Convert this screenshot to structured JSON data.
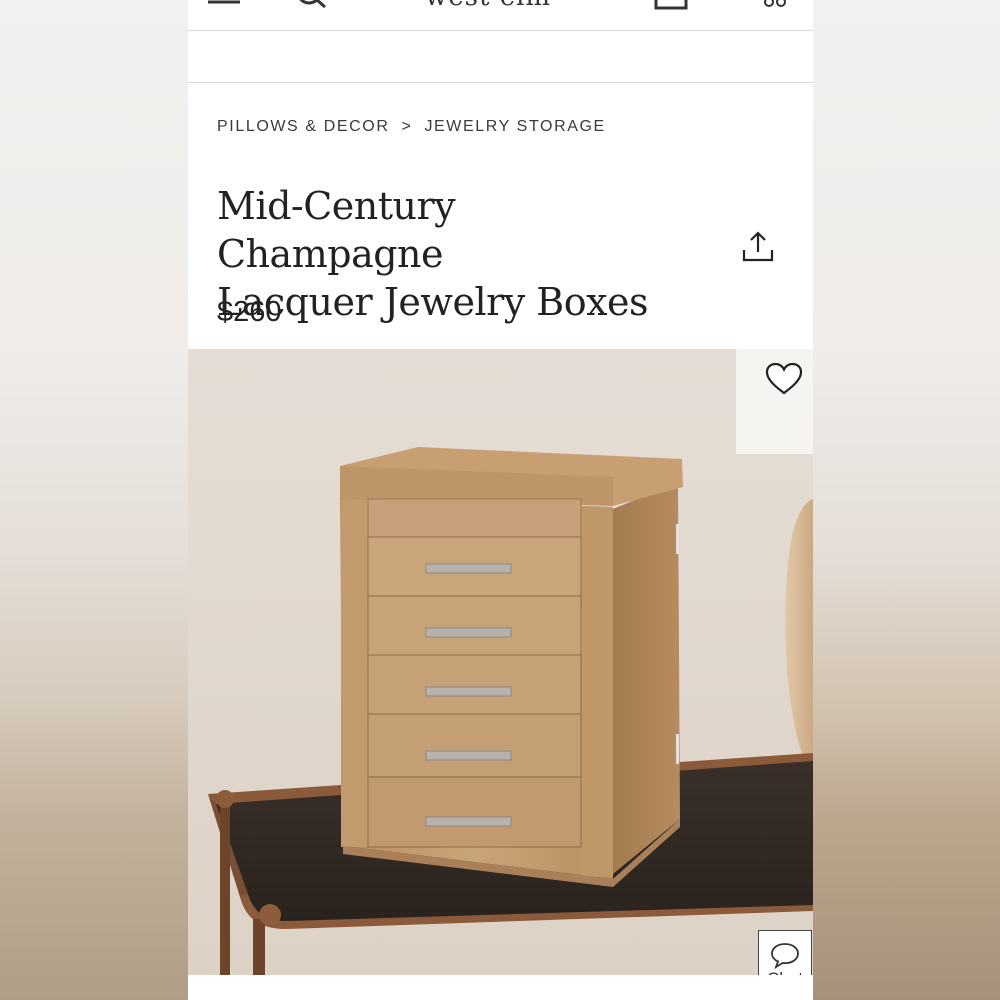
{
  "header": {
    "brand": "west elm",
    "menu_icon": "menu-icon",
    "search_icon": "search-icon",
    "cart_icon": "cart-icon",
    "account_icon": "account-icon"
  },
  "breadcrumb": {
    "items": [
      "PILLOWS & DECOR",
      "JEWELRY STORAGE"
    ],
    "separator": ">"
  },
  "product": {
    "title_line1": "Mid-Century Champagne",
    "title_line2": "Lacquer Jewelry Boxes",
    "price": "$260"
  },
  "actions": {
    "share_icon": "share-icon",
    "favorite_icon": "heart-icon",
    "chat_label": "Chat"
  },
  "colors": {
    "text": "#222222",
    "divider": "#d8d8d8",
    "champagne": "#c49a6c"
  }
}
